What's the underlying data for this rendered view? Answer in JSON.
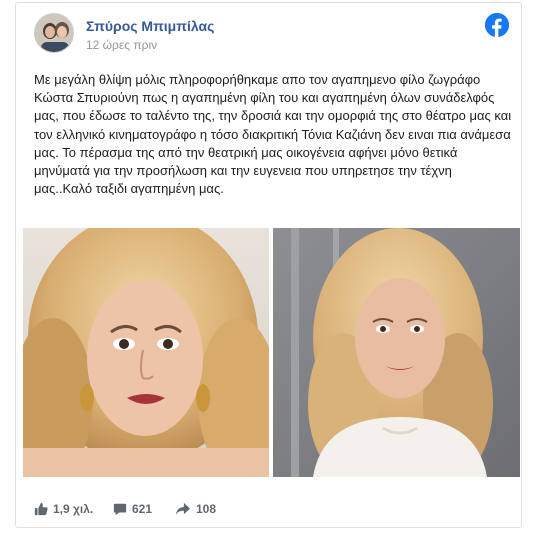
{
  "post": {
    "author": "Σπύρος Μπιμπίλας",
    "time": "12 ώρες πριν",
    "text": "Με μεγάλη θλίψη μόλις πληροφορήθηκαμε απο τον αγαπημενο φίλο ζωγράφο Κώστα Σπυριούνη πως η αγαπημένη φίλη του και αγαπημένη όλων συνάδελφός μας, που έδωσε το ταλέντο της, την δροσιά και την ομορφιά της στο θέατρο μας και τον ελληνικό κινηματογράφο η τόσο διακριτική Τόνια Καζιάνη δεν ειναι πια ανάμεσα μας. Το πέρασμα της από την θεατρική μας οικογένεια αφήνει μόνο θετικά μηνύματά για την προσήλωση και την ευγενεια που υπηρετησε την τέχνη μας..Καλό ταξιδι αγαπημένη μας."
  },
  "stats": {
    "likes": "1,9 χιλ.",
    "comments": "621",
    "shares": "108"
  },
  "icons": {
    "brand": "facebook-icon",
    "like": "thumbs-up-icon",
    "comment": "comment-icon",
    "share": "share-arrow-icon"
  },
  "colors": {
    "author": "#365899",
    "facebook": "#1877f2",
    "meta": "#90949c",
    "footer": "#606770"
  }
}
